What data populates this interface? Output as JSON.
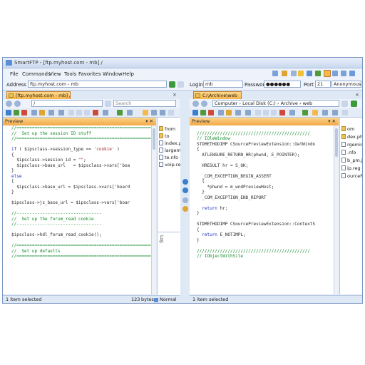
{
  "window": {
    "title": "SmartFTP - [ftp.myhost.com - mb] /"
  },
  "menu": {
    "items": [
      "File",
      "Commands",
      "View",
      "Tools",
      "Favorites",
      "Window",
      "Help"
    ]
  },
  "address_bar": {
    "address_label": "Address",
    "address_value": "ftp.myhost.com - mb",
    "login_label": "Login",
    "login_value": "mb",
    "password_label": "Password",
    "password_value": "●●●●●●",
    "port_label": "Port",
    "port_value": "21",
    "mode_value": "Anonymous"
  },
  "left_pane": {
    "tab_label": "[ftp.myhost.com - mb] /",
    "path_value": "/",
    "search_placeholder": "Search",
    "preview_label": "Preview",
    "files": [
      "from",
      "to",
      "index.p",
      "largem",
      "te.nfo",
      "voip.re"
    ],
    "status_left": "1 item selected",
    "status_size": "123",
    "status_unit": "bytes",
    "status_mode": "Normal"
  },
  "right_pane": {
    "tab_label": "C:\\Archive\\web",
    "breadcrumb": [
      "Computer",
      "Local Disk (C:)",
      "Archive",
      "web"
    ],
    "preview_label": "Preview",
    "files": [
      "om",
      "dex.php",
      "rgeminus.g",
      ".nfo",
      "b_pm.js",
      "ip.reg",
      "ourcePreviewEx"
    ],
    "status_left": "1 item selected"
  },
  "log_label": "Log",
  "left_code": [
    [
      [
        "c-cmt",
        "//========================================================="
      ]
    ],
    [
      [
        "c-cmt",
        "//  Set up the session ID stuff"
      ]
    ],
    [
      [
        "c-cmt",
        "//========================================================="
      ]
    ],
    [
      [
        "c-plain",
        ""
      ]
    ],
    [
      [
        "c-kw",
        "if"
      ],
      [
        "c-plain",
        " ( $ipsclass->session_type == "
      ],
      [
        "c-str",
        "'cookie'"
      ],
      [
        "c-plain",
        " )"
      ]
    ],
    [
      [
        "c-plain",
        "{"
      ]
    ],
    [
      [
        "c-plain",
        "  $ipsclass->session_id = "
      ],
      [
        "c-str",
        "\"\""
      ],
      [
        "c-plain",
        ";"
      ]
    ],
    [
      [
        "c-plain",
        "  $ipsclass->base_url   = $ipsclass->vars['boa"
      ]
    ],
    [
      [
        "c-plain",
        "}"
      ]
    ],
    [
      [
        "c-kw",
        "else"
      ]
    ],
    [
      [
        "c-plain",
        "{"
      ]
    ],
    [
      [
        "c-plain",
        "  $ipsclass->base_url = $ipsclass->vars['board"
      ]
    ],
    [
      [
        "c-plain",
        "}"
      ]
    ],
    [
      [
        "c-plain",
        ""
      ]
    ],
    [
      [
        "c-plain",
        "$ipsclass->js_base_url = $ipsclass->vars['boar"
      ]
    ],
    [
      [
        "c-plain",
        ""
      ]
    ],
    [
      [
        "c-cmt",
        "//---------------------------------"
      ]
    ],
    [
      [
        "c-cmt",
        "//  Set up the forum_read cookie"
      ]
    ],
    [
      [
        "c-cmt",
        "//---------------------------------"
      ]
    ],
    [
      [
        "c-plain",
        ""
      ]
    ],
    [
      [
        "c-plain",
        "$ipsclass->hdl_forum_read_cookie();"
      ]
    ],
    [
      [
        "c-plain",
        ""
      ]
    ],
    [
      [
        "c-cmt",
        "//========================================================="
      ]
    ],
    [
      [
        "c-cmt",
        "//  Set up defaults"
      ]
    ],
    [
      [
        "c-cmt",
        "//========================================================="
      ]
    ]
  ],
  "right_code": [
    [
      [
        "c-plain",
        ""
      ]
    ],
    [
      [
        "c-cmt",
        "////////////////////////////////////////////"
      ]
    ],
    [
      [
        "c-cmt",
        "// IOleWindow"
      ]
    ],
    [
      [
        "c-plain",
        "STDMETHODIMP CSourcePreviewExtension::GetWindo"
      ]
    ],
    [
      [
        "c-plain",
        "{"
      ]
    ],
    [
      [
        "c-plain",
        "  ATLENSURE_RETURN_HR(phwnd, E_POINTER);"
      ]
    ],
    [
      [
        "c-plain",
        ""
      ]
    ],
    [
      [
        "c-plain",
        "  HRESULT hr = S_OK;"
      ]
    ],
    [
      [
        "c-plain",
        ""
      ]
    ],
    [
      [
        "c-plain",
        "  _COM_EXCEPTION_BEGIN_ASSERT"
      ]
    ],
    [
      [
        "c-plain",
        "  {"
      ]
    ],
    [
      [
        "c-plain",
        "    *phwnd = m_wndPreviewHost;"
      ]
    ],
    [
      [
        "c-plain",
        "  }"
      ]
    ],
    [
      [
        "c-plain",
        "  _COM_EXCEPTION_END_REPORT"
      ]
    ],
    [
      [
        "c-plain",
        ""
      ]
    ],
    [
      [
        "c-plain",
        "  "
      ],
      [
        "c-kw",
        "return"
      ],
      [
        "c-plain",
        " hr;"
      ]
    ],
    [
      [
        "c-plain",
        "}"
      ]
    ],
    [
      [
        "c-plain",
        ""
      ]
    ],
    [
      [
        "c-plain",
        "STDMETHODIMP CSourcePreviewExtension::ContextS"
      ]
    ],
    [
      [
        "c-plain",
        "{"
      ]
    ],
    [
      [
        "c-plain",
        "  "
      ],
      [
        "c-kw",
        "return"
      ],
      [
        "c-plain",
        " E_NOTIMPL;"
      ]
    ],
    [
      [
        "c-plain",
        "}"
      ]
    ],
    [
      [
        "c-plain",
        ""
      ]
    ],
    [
      [
        "c-cmt",
        "////////////////////////////////////////////"
      ]
    ],
    [
      [
        "c-cmt",
        "// IObjectWithSite"
      ]
    ]
  ]
}
